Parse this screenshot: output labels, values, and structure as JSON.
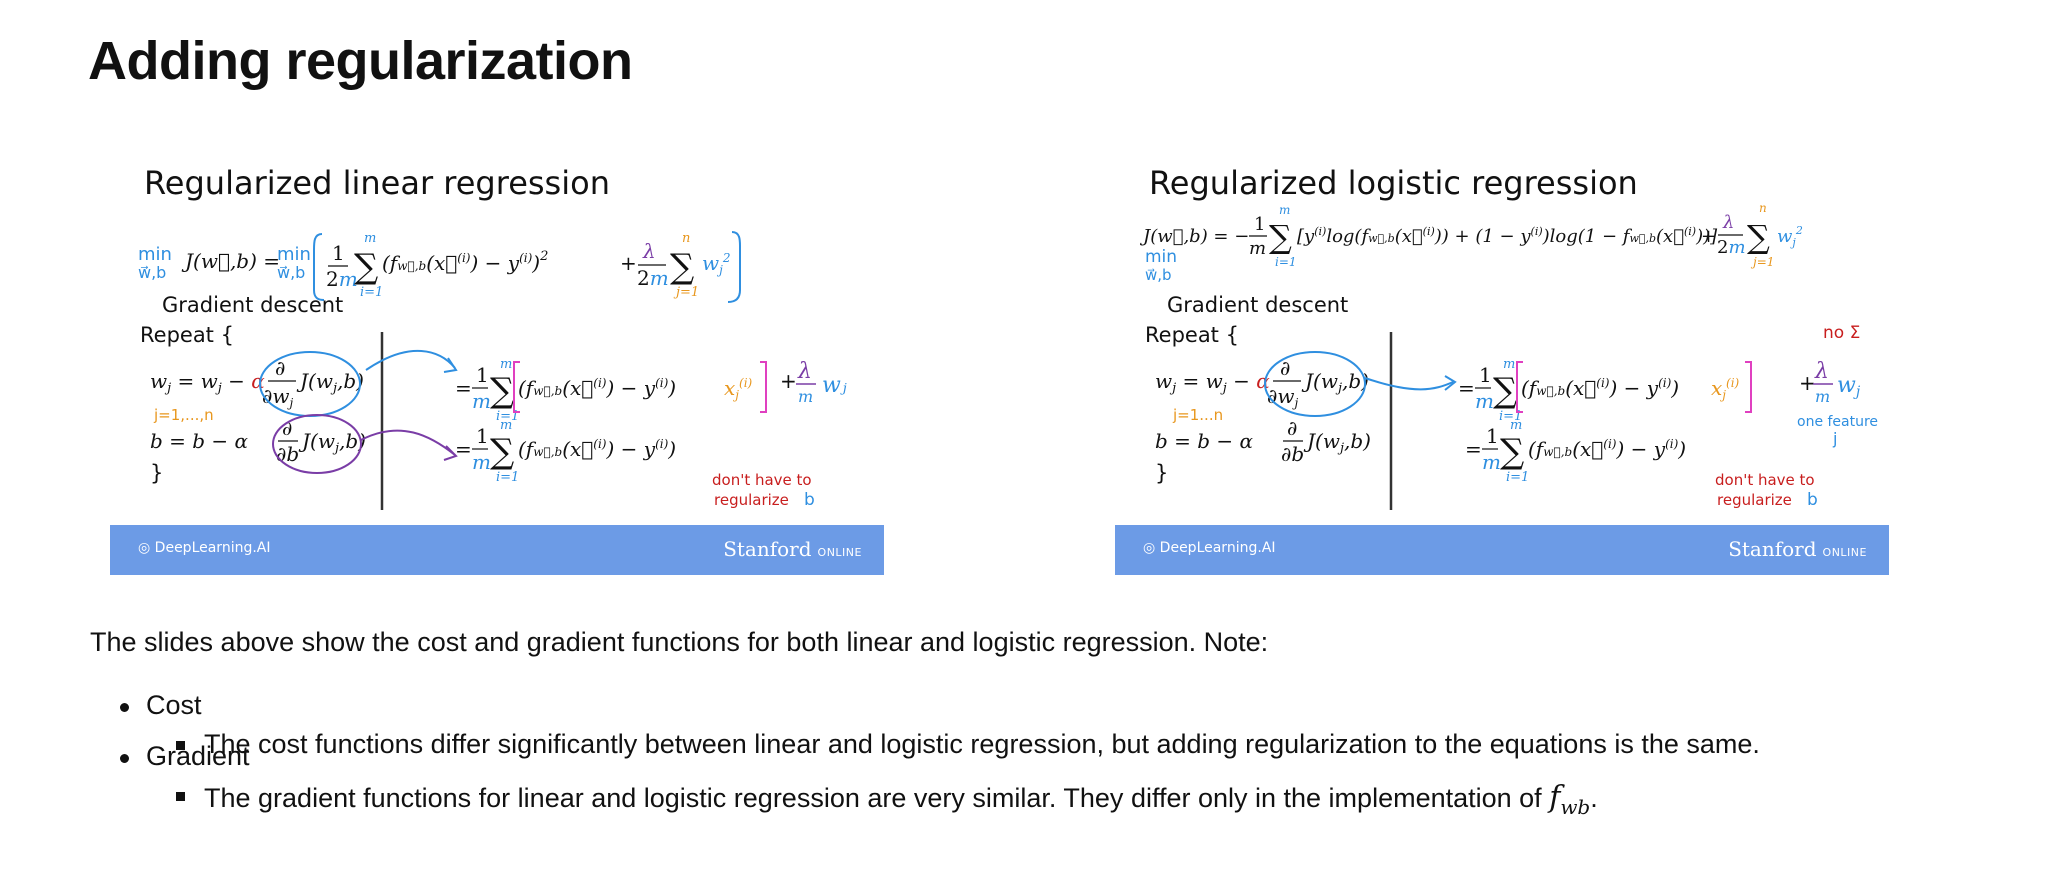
{
  "page": {
    "title": "Adding regularization"
  },
  "slides": [
    {
      "title": "Regularized linear regression",
      "cost_lhs": "J(w⃗,b) =",
      "min_label": "min",
      "min_sub": "w⃗,b",
      "gd_label": "Gradient descent",
      "repeat": "Repeat {",
      "close": "}",
      "wupdate": "wⱼ = wⱼ − α",
      "bupdate": "b = b − α",
      "jidx": "j=1,...,n",
      "lambda_m": "λ",
      "w_j": "wⱼ",
      "no_reg_b": "don't have to",
      "no_reg_b2": "regularize",
      "b_letter": "b",
      "brand": "DeepLearning.AI",
      "stanford": "Stanford",
      "online": "ONLINE"
    },
    {
      "title": "Regularized logistic regression",
      "cost_lhs": "J(w⃗,b) = −",
      "min_label": "min",
      "min_sub": "w⃗,b",
      "gd_label": "Gradient descent",
      "repeat": "Repeat {",
      "close": "}",
      "wupdate": "wⱼ = wⱼ − α",
      "bupdate": "b = b − α",
      "jidx": "j=1...n",
      "no_sigma": "no Σ",
      "one_feature": "one feature",
      "j_letter": "j",
      "no_reg_b": "don't have to",
      "no_reg_b2": "regularize",
      "b_letter": "b",
      "brand": "DeepLearning.AI",
      "stanford": "Stanford",
      "online": "ONLINE"
    }
  ],
  "note": "The slides above show the cost and gradient functions for both linear and logistic regression. Note:",
  "bullets": [
    {
      "label": "Cost",
      "sub": "The cost functions differ significantly between linear and logistic regression, but adding regularization to the equations is the same."
    },
    {
      "label": "Gradient",
      "sub": "The gradient functions for linear and logistic regression are very similar. They differ only in the implementation of"
    }
  ],
  "fwb": {
    "f": "f",
    "sub": "wb",
    "end": "."
  },
  "colors": {
    "blue_hand": "#2f8fe0",
    "orange_hand": "#e8971e",
    "red_hand": "#c81e1e",
    "purple_hand": "#7a3da6",
    "pink_hand": "#e040c0",
    "footer": "#6c9be6"
  }
}
